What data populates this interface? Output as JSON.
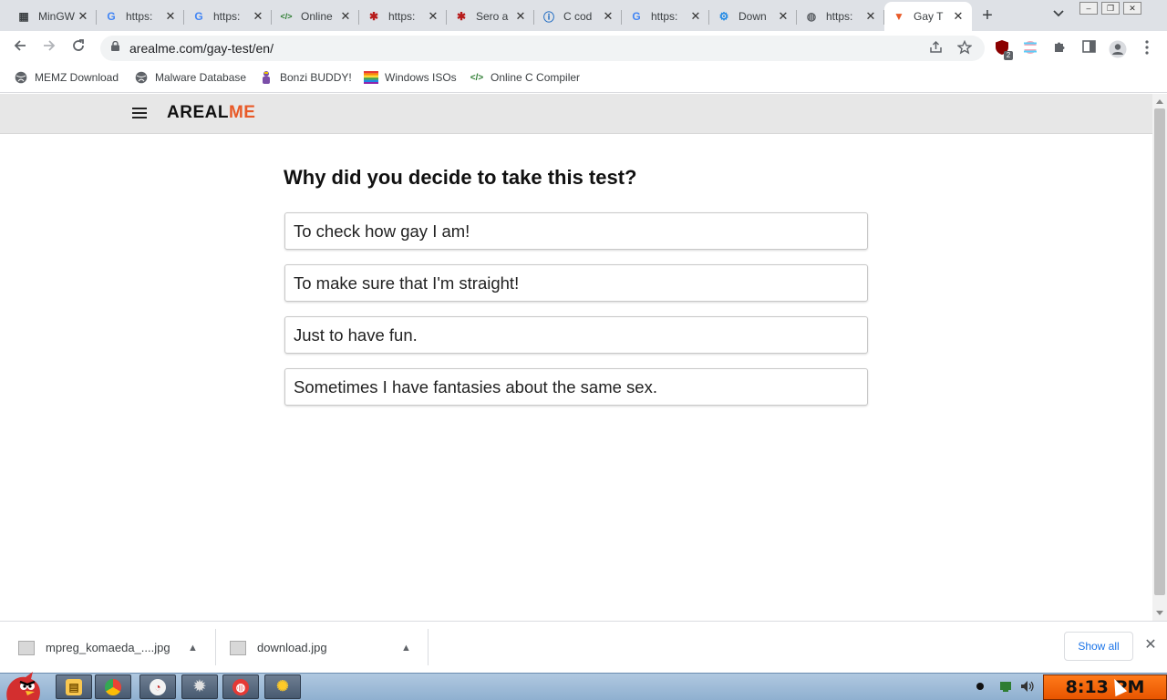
{
  "tabs": [
    {
      "title": "MinGW",
      "icon": "grid-icon",
      "color": "#3c4043"
    },
    {
      "title": "https:",
      "icon": "google-icon",
      "color": "#4285f4"
    },
    {
      "title": "https:",
      "icon": "google-icon",
      "color": "#4285f4"
    },
    {
      "title": "Online",
      "icon": "code-icon",
      "color": "#2e7d32"
    },
    {
      "title": "https:",
      "icon": "spider-icon",
      "color": "#b71c1c"
    },
    {
      "title": "Sero a",
      "icon": "spider-icon",
      "color": "#b71c1c"
    },
    {
      "title": "C cod",
      "icon": "info-icon",
      "color": "#1565c0"
    },
    {
      "title": "https:",
      "icon": "google-icon",
      "color": "#4285f4"
    },
    {
      "title": "Down",
      "icon": "gear-icon",
      "color": "#1e88e5"
    },
    {
      "title": "https:",
      "icon": "globe-icon",
      "color": "#5f6368"
    },
    {
      "title": "Gay T",
      "icon": "fox-icon",
      "color": "#e85a28",
      "active": true
    }
  ],
  "address": {
    "url": "arealme.com/gay-test/en/"
  },
  "bookmarks": [
    {
      "label": "MEMZ Download",
      "icon": "globe-icon"
    },
    {
      "label": "Malware Database",
      "icon": "globe-icon"
    },
    {
      "label": "Bonzi BUDDY!",
      "icon": "bonzi-icon"
    },
    {
      "label": "Windows ISOs",
      "icon": "windows-flag-icon"
    },
    {
      "label": "Online C Compiler",
      "icon": "code-icon"
    }
  ],
  "extensions_badge": "2",
  "site": {
    "logo_part1": "AREAL",
    "logo_part2": "ME",
    "accent": "#e85a28"
  },
  "quiz": {
    "question": "Why did you decide to take this test?",
    "options": [
      "To check how gay I am!",
      "To make sure that I'm straight!",
      "Just to have fun.",
      "Sometimes I have fantasies about the same sex."
    ]
  },
  "downloads": {
    "items": [
      {
        "filename": "mpreg_komaeda_....jpg"
      },
      {
        "filename": "download.jpg"
      }
    ],
    "show_all": "Show all"
  },
  "taskbar": {
    "clock": "8:13 PM"
  }
}
